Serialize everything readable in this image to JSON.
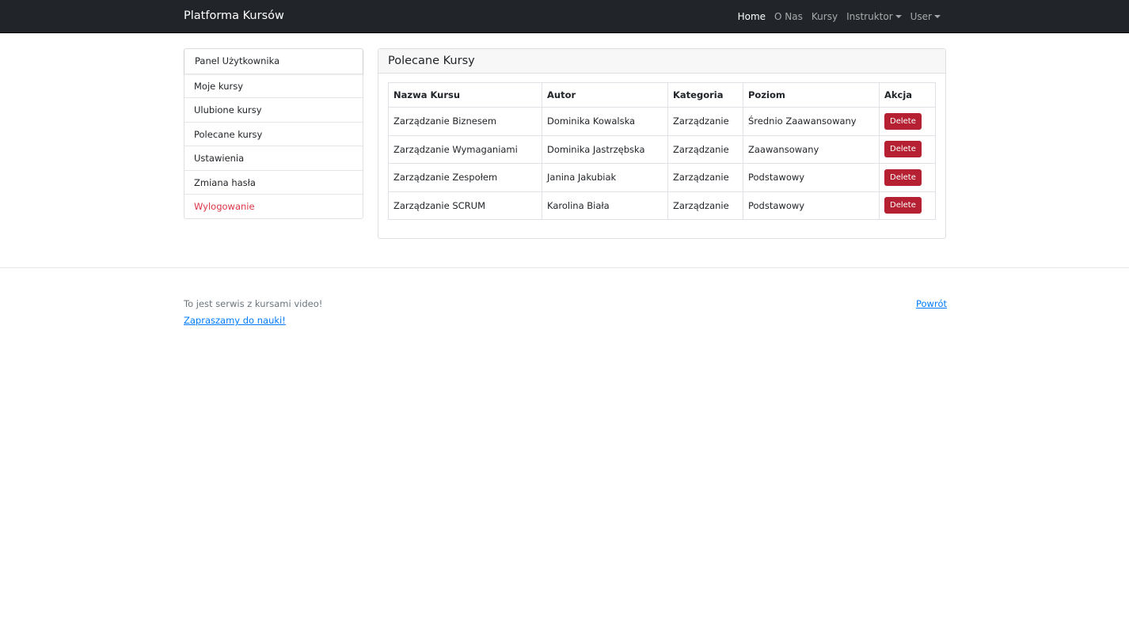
{
  "navbar": {
    "brand": "Platforma Kursów",
    "links": [
      "Home",
      "O Nas",
      "Kursy",
      "Instruktor",
      "User"
    ]
  },
  "sidebar": {
    "items": [
      "Panel Użytkownika",
      "Moje kursy",
      "Ulubione kursy",
      "Polecane kursy",
      "Ustawienia",
      "Zmiana hasła",
      "Wylogowanie"
    ]
  },
  "card": {
    "title": "Polecane Kursy",
    "headers": [
      "Nazwa Kursu",
      "Autor",
      "Kategoria",
      "Poziom",
      "Akcja"
    ],
    "rows": [
      [
        "Zarządzanie Biznesem",
        "Dominika Kowalska",
        "Zarządzanie",
        "Średnio Zaawansowany",
        "Delete"
      ],
      [
        "Zarządzanie Wymaganiami",
        "Dominika Jastrzębska",
        "Zarządzanie",
        "Zaawansowany",
        "Delete"
      ],
      [
        "Zarządzanie Zespołem",
        "Janina Jakubiak",
        "Zarządzanie",
        "Podstawowy",
        "Delete"
      ],
      [
        "Zarządzanie SCRUM",
        "Karolina Biała",
        "Zarządzanie",
        "Podstawowy",
        "Delete"
      ]
    ]
  },
  "footer": {
    "text": "To jest serwis z kursami video!",
    "link": "Zapraszamy do nauki!",
    "back": "Powrót"
  }
}
